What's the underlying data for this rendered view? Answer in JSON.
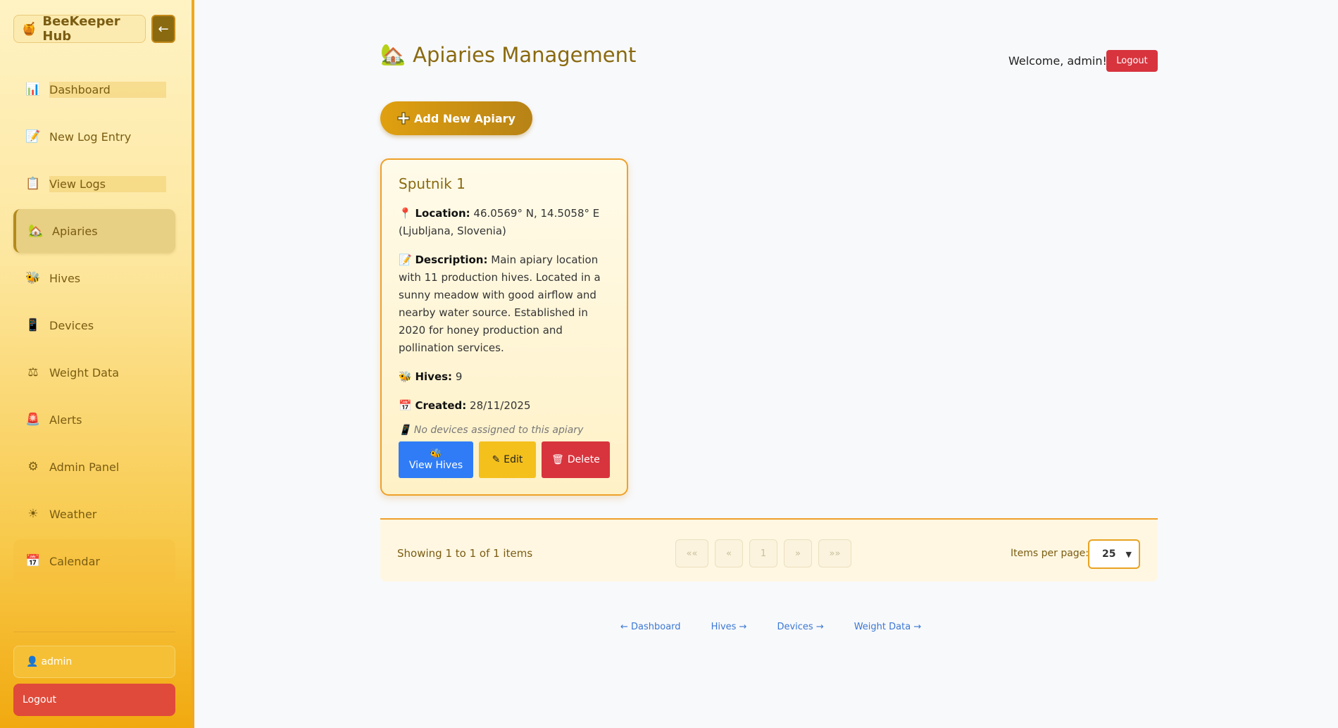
{
  "sidebar": {
    "brand": "BeeKeeper Hub",
    "brand_icon": "honey-pot-icon",
    "collapse_label": "←",
    "items": [
      {
        "label": "Dashboard",
        "icon": "📊"
      },
      {
        "label": "New Log Entry",
        "icon": "📝"
      },
      {
        "label": "View Logs",
        "icon": "📋"
      },
      {
        "label": "Apiaries",
        "icon": "🏡"
      },
      {
        "label": "Hives",
        "icon": "🐝"
      },
      {
        "label": "Devices",
        "icon": "📱"
      },
      {
        "label": "Weight Data",
        "icon": "⚖"
      },
      {
        "label": "Alerts",
        "icon": "🚨"
      },
      {
        "label": "Admin Panel",
        "icon": "⚙"
      },
      {
        "label": "Weather",
        "icon": "☀"
      },
      {
        "label": "Calendar",
        "icon": "📅"
      }
    ],
    "user": "admin",
    "logout": "Logout"
  },
  "header": {
    "title": "Apiaries Management",
    "title_icon": "🏡",
    "welcome": "Welcome, admin!",
    "logout": "Logout"
  },
  "add_button": "Add New Apiary",
  "apiary": {
    "name": "Sputnik 1",
    "location_label": "Location:",
    "location": "46.0569° N, 14.5058° E (Ljubljana, Slovenia)",
    "description_label": "Description:",
    "description": "Main apiary location with 11 production hives. Located in a sunny meadow with good airflow and nearby water source. Established in 2020 for honey production and pollination services.",
    "hives_label": "Hives:",
    "hives": "9",
    "created_label": "Created:",
    "created": "28/11/2025",
    "no_devices": "No devices assigned to this apiary",
    "view_hives": "View Hives",
    "edit": "Edit",
    "delete": "Delete"
  },
  "pagination": {
    "showing": "Showing 1 to 1 of 1 items",
    "first": "««",
    "prev": "«",
    "page": "1",
    "next": "»",
    "last": "»»",
    "items_per_page_label": "Items per page:",
    "items_per_page": "25"
  },
  "footer_links": {
    "dashboard": "← Dashboard",
    "hives": "Hives →",
    "devices": "Devices →",
    "weight": "Weight Data →"
  }
}
